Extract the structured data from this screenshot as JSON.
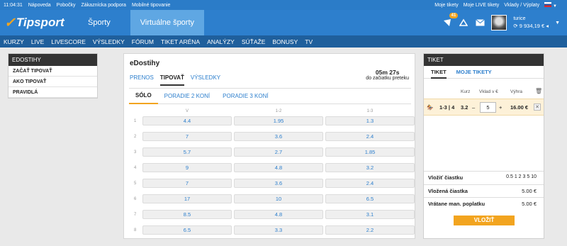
{
  "topbar": {
    "time": "11:04:31",
    "links": [
      "Nápoveda",
      "Pobočky",
      "Zákaznícka podpora",
      "Mobilné tipovanie"
    ],
    "right_links": [
      "Moje tikety",
      "Moje LIVE tikety",
      "Vklady / Výplaty"
    ]
  },
  "header": {
    "logo": "Tipsport",
    "tabs": [
      "Športy",
      "Virtuálne športy"
    ],
    "active_tab": "Virtuálne športy",
    "notification_count": "41",
    "user": {
      "name": "turice",
      "balance": "9 934,19",
      "currency": "€"
    }
  },
  "mainnav": [
    "KURZY",
    "LIVE",
    "LIVESCORE",
    "VÝSLEDKY",
    "FÓRUM",
    "TIKET ARÉNA",
    "ANALÝZY",
    "SÚŤAŽE",
    "BONUSY",
    "TV"
  ],
  "leftpanel": {
    "title": "EDOSTIHY",
    "items": [
      "ZAČAŤ TIPOVAŤ",
      "AKO TIPOVAŤ",
      "PRAVIDLÁ"
    ]
  },
  "center": {
    "title": "eDostihy",
    "timer": "05m 27s",
    "timer_label": "do začiatku preteku",
    "tabs": [
      "PRENOS",
      "TIPOVAŤ",
      "VÝSLEDKY"
    ],
    "subtabs": [
      "SÓLO",
      "PORADIE 2 KONÍ",
      "PORADIE 3 KONÍ"
    ],
    "columns": [
      "V",
      "1-2",
      "1-3"
    ],
    "rows": [
      {
        "n": "1",
        "odds": [
          "4.4",
          "1.95",
          "1.3"
        ]
      },
      {
        "n": "2",
        "odds": [
          "7",
          "3.6",
          "2.4"
        ]
      },
      {
        "n": "3",
        "odds": [
          "5.7",
          "2.7",
          "1.85"
        ]
      },
      {
        "n": "4",
        "odds": [
          "9",
          "4.8",
          "3.2"
        ]
      },
      {
        "n": "5",
        "odds": [
          "7",
          "3.6",
          "2.4"
        ]
      },
      {
        "n": "6",
        "odds": [
          "17",
          "10",
          "6.5"
        ]
      },
      {
        "n": "7",
        "odds": [
          "8.5",
          "4.8",
          "3.1"
        ]
      },
      {
        "n": "8",
        "odds": [
          "6.5",
          "3.3",
          "2.2"
        ]
      }
    ]
  },
  "ticket": {
    "title": "TIKET",
    "tabs": [
      "TIKET",
      "MOJE TIKETY"
    ],
    "headers": {
      "kurz": "Kurz",
      "vklad": "Vklad v €",
      "vyhra": "Výhra"
    },
    "bet": {
      "selection": "1-3 | 4",
      "odds": "3.2",
      "minus": "–",
      "stake": "5",
      "plus": "+",
      "win": "16.00 €",
      "remove": "✕"
    },
    "vlozit_label": "Vložiť čiastku",
    "amounts": "0.5 1 2 3 5 10",
    "vlozena_label": "Vložená čiastka",
    "vlozena_value": "5.00 €",
    "vratane_label": "Vrátane man. poplatku",
    "vratane_value": "5.00 €",
    "button": "VLOŽIŤ"
  }
}
